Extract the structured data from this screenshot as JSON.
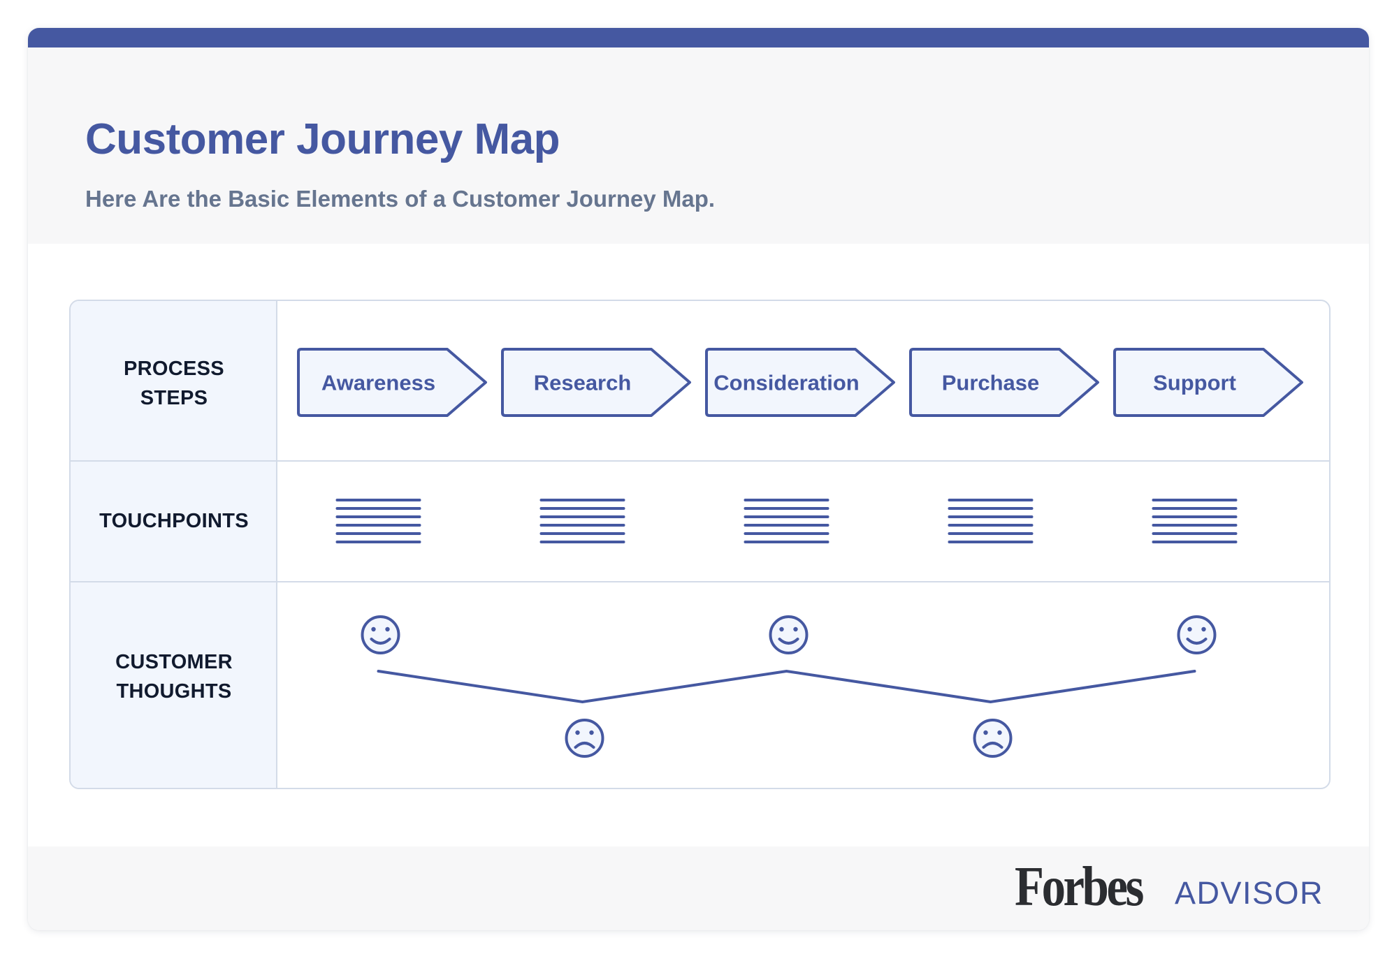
{
  "header": {
    "title": "Customer Journey Map",
    "subtitle": "Here Are the Basic Elements of a Customer Journey Map."
  },
  "rows": [
    {
      "label_lines": [
        "PROCESS",
        "STEPS"
      ]
    },
    {
      "label_lines": [
        "TOUCHPOINTS"
      ]
    },
    {
      "label_lines": [
        "CUSTOMER",
        "THOUGHTS"
      ]
    }
  ],
  "process_steps": [
    "Awareness",
    "Research",
    "Consideration",
    "Purchase",
    "Support"
  ],
  "touchpoints": {
    "count": 5,
    "icon": "text-lines-icon",
    "lines_per_icon": 6
  },
  "customer_thoughts": [
    {
      "step": "Awareness",
      "sentiment": "positive",
      "icon": "happy-face-icon"
    },
    {
      "step": "Research",
      "sentiment": "negative",
      "icon": "sad-face-icon"
    },
    {
      "step": "Consideration",
      "sentiment": "positive",
      "icon": "happy-face-icon"
    },
    {
      "step": "Purchase",
      "sentiment": "negative",
      "icon": "sad-face-icon"
    },
    {
      "step": "Support",
      "sentiment": "positive",
      "icon": "happy-face-icon"
    }
  ],
  "footer": {
    "brand": "Forbes",
    "brand_suffix": "ADVISOR"
  },
  "colors": {
    "accent": "#4558a1",
    "label_text": "#111a2e",
    "subtitle": "#66758f",
    "label_column_bg": "#f2f6fd",
    "border": "#d3dbe8",
    "header_bg": "#f7f7f8"
  }
}
